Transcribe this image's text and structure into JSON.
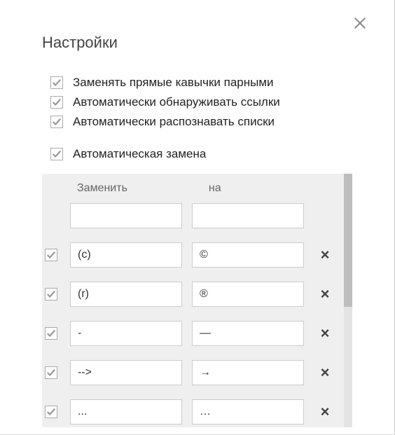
{
  "title": "Настройки",
  "options": [
    {
      "checked": true,
      "label": "Заменять прямые кавычки парными"
    },
    {
      "checked": true,
      "label": "Автоматически обнаруживать ссылки"
    },
    {
      "checked": true,
      "label": "Автоматически распознавать списки"
    }
  ],
  "autocorrect": {
    "label": "Автоматическая замена",
    "checked": true,
    "header_from": "Заменить",
    "header_to": "на",
    "new_row": {
      "from": "",
      "to": ""
    },
    "rows": [
      {
        "checked": true,
        "from": "(c)",
        "to": "©"
      },
      {
        "checked": true,
        "from": "(r)",
        "to": "®"
      },
      {
        "checked": true,
        "from": "-",
        "to": "—"
      },
      {
        "checked": true,
        "from": "-->",
        "to": "→"
      },
      {
        "checked": true,
        "from": "...",
        "to": "…"
      }
    ]
  }
}
